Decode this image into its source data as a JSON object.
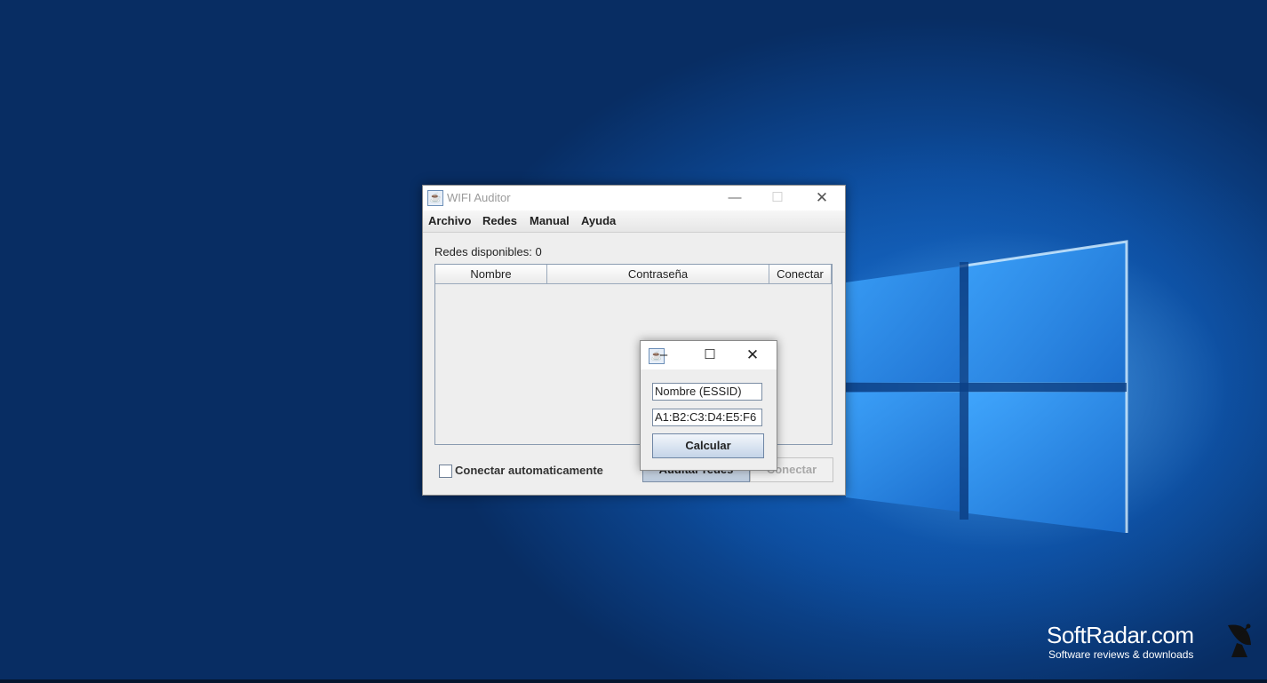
{
  "main_window": {
    "title": "WIFI Auditor",
    "menu": [
      "Archivo",
      "Redes",
      "Manual",
      "Ayuda"
    ],
    "redes_label": "Redes disponibles: 0",
    "table": {
      "columns": [
        "Nombre",
        "Contraseña",
        "Conectar"
      ],
      "rows": []
    },
    "auto_connect_label": "Conectar automaticamente",
    "auto_connect_checked": false,
    "auditar_button": "Auditar redes",
    "conectar_button": "Conectar"
  },
  "dialog": {
    "essid_value": "Nombre (ESSID)",
    "mac_value": "A1:B2:C3:D4:E5:F6",
    "calcular_button": "Calcular"
  },
  "watermark": {
    "title": "SoftRadar.com",
    "subtitle": "Software reviews & downloads"
  },
  "icons": {
    "app": "java-coffee-icon",
    "minimize": "minimize-icon",
    "maximize": "maximize-icon",
    "close": "close-icon",
    "watermark": "satellite-dish-icon"
  }
}
